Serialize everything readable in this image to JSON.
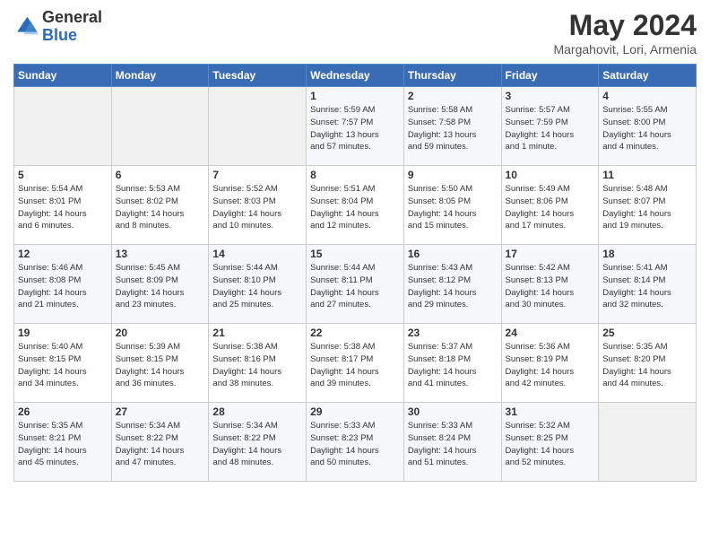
{
  "header": {
    "logo_general": "General",
    "logo_blue": "Blue",
    "month_year": "May 2024",
    "location": "Margahovit, Lori, Armenia"
  },
  "weekdays": [
    "Sunday",
    "Monday",
    "Tuesday",
    "Wednesday",
    "Thursday",
    "Friday",
    "Saturday"
  ],
  "weeks": [
    [
      {
        "day": "",
        "info": ""
      },
      {
        "day": "",
        "info": ""
      },
      {
        "day": "",
        "info": ""
      },
      {
        "day": "1",
        "info": "Sunrise: 5:59 AM\nSunset: 7:57 PM\nDaylight: 13 hours\nand 57 minutes."
      },
      {
        "day": "2",
        "info": "Sunrise: 5:58 AM\nSunset: 7:58 PM\nDaylight: 13 hours\nand 59 minutes."
      },
      {
        "day": "3",
        "info": "Sunrise: 5:57 AM\nSunset: 7:59 PM\nDaylight: 14 hours\nand 1 minute."
      },
      {
        "day": "4",
        "info": "Sunrise: 5:55 AM\nSunset: 8:00 PM\nDaylight: 14 hours\nand 4 minutes."
      }
    ],
    [
      {
        "day": "5",
        "info": "Sunrise: 5:54 AM\nSunset: 8:01 PM\nDaylight: 14 hours\nand 6 minutes."
      },
      {
        "day": "6",
        "info": "Sunrise: 5:53 AM\nSunset: 8:02 PM\nDaylight: 14 hours\nand 8 minutes."
      },
      {
        "day": "7",
        "info": "Sunrise: 5:52 AM\nSunset: 8:03 PM\nDaylight: 14 hours\nand 10 minutes."
      },
      {
        "day": "8",
        "info": "Sunrise: 5:51 AM\nSunset: 8:04 PM\nDaylight: 14 hours\nand 12 minutes."
      },
      {
        "day": "9",
        "info": "Sunrise: 5:50 AM\nSunset: 8:05 PM\nDaylight: 14 hours\nand 15 minutes."
      },
      {
        "day": "10",
        "info": "Sunrise: 5:49 AM\nSunset: 8:06 PM\nDaylight: 14 hours\nand 17 minutes."
      },
      {
        "day": "11",
        "info": "Sunrise: 5:48 AM\nSunset: 8:07 PM\nDaylight: 14 hours\nand 19 minutes."
      }
    ],
    [
      {
        "day": "12",
        "info": "Sunrise: 5:46 AM\nSunset: 8:08 PM\nDaylight: 14 hours\nand 21 minutes."
      },
      {
        "day": "13",
        "info": "Sunrise: 5:45 AM\nSunset: 8:09 PM\nDaylight: 14 hours\nand 23 minutes."
      },
      {
        "day": "14",
        "info": "Sunrise: 5:44 AM\nSunset: 8:10 PM\nDaylight: 14 hours\nand 25 minutes."
      },
      {
        "day": "15",
        "info": "Sunrise: 5:44 AM\nSunset: 8:11 PM\nDaylight: 14 hours\nand 27 minutes."
      },
      {
        "day": "16",
        "info": "Sunrise: 5:43 AM\nSunset: 8:12 PM\nDaylight: 14 hours\nand 29 minutes."
      },
      {
        "day": "17",
        "info": "Sunrise: 5:42 AM\nSunset: 8:13 PM\nDaylight: 14 hours\nand 30 minutes."
      },
      {
        "day": "18",
        "info": "Sunrise: 5:41 AM\nSunset: 8:14 PM\nDaylight: 14 hours\nand 32 minutes."
      }
    ],
    [
      {
        "day": "19",
        "info": "Sunrise: 5:40 AM\nSunset: 8:15 PM\nDaylight: 14 hours\nand 34 minutes."
      },
      {
        "day": "20",
        "info": "Sunrise: 5:39 AM\nSunset: 8:15 PM\nDaylight: 14 hours\nand 36 minutes."
      },
      {
        "day": "21",
        "info": "Sunrise: 5:38 AM\nSunset: 8:16 PM\nDaylight: 14 hours\nand 38 minutes."
      },
      {
        "day": "22",
        "info": "Sunrise: 5:38 AM\nSunset: 8:17 PM\nDaylight: 14 hours\nand 39 minutes."
      },
      {
        "day": "23",
        "info": "Sunrise: 5:37 AM\nSunset: 8:18 PM\nDaylight: 14 hours\nand 41 minutes."
      },
      {
        "day": "24",
        "info": "Sunrise: 5:36 AM\nSunset: 8:19 PM\nDaylight: 14 hours\nand 42 minutes."
      },
      {
        "day": "25",
        "info": "Sunrise: 5:35 AM\nSunset: 8:20 PM\nDaylight: 14 hours\nand 44 minutes."
      }
    ],
    [
      {
        "day": "26",
        "info": "Sunrise: 5:35 AM\nSunset: 8:21 PM\nDaylight: 14 hours\nand 45 minutes."
      },
      {
        "day": "27",
        "info": "Sunrise: 5:34 AM\nSunset: 8:22 PM\nDaylight: 14 hours\nand 47 minutes."
      },
      {
        "day": "28",
        "info": "Sunrise: 5:34 AM\nSunset: 8:22 PM\nDaylight: 14 hours\nand 48 minutes."
      },
      {
        "day": "29",
        "info": "Sunrise: 5:33 AM\nSunset: 8:23 PM\nDaylight: 14 hours\nand 50 minutes."
      },
      {
        "day": "30",
        "info": "Sunrise: 5:33 AM\nSunset: 8:24 PM\nDaylight: 14 hours\nand 51 minutes."
      },
      {
        "day": "31",
        "info": "Sunrise: 5:32 AM\nSunset: 8:25 PM\nDaylight: 14 hours\nand 52 minutes."
      },
      {
        "day": "",
        "info": ""
      }
    ]
  ]
}
